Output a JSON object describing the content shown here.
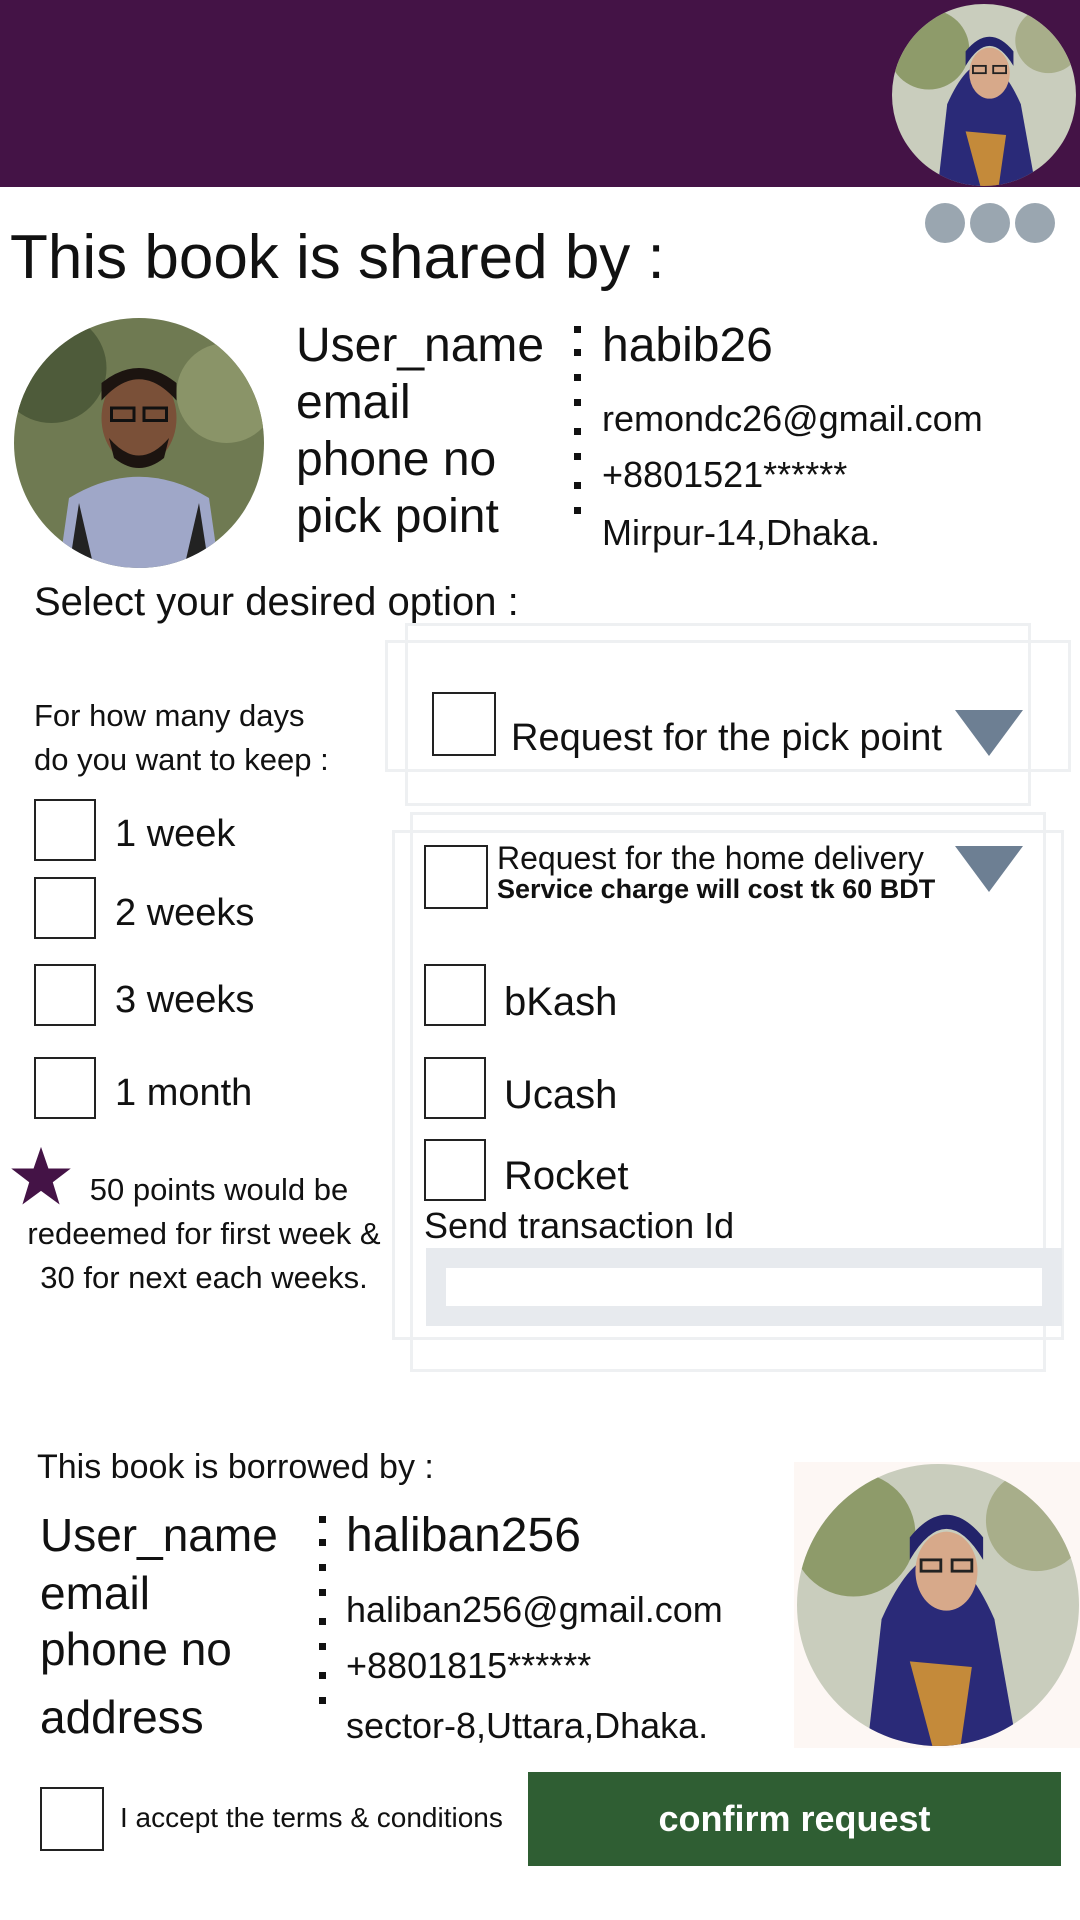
{
  "header": {
    "menu_icon": "more-dots-icon",
    "bar_color": "#441346"
  },
  "sharer": {
    "title": "This book is shared by :",
    "labels": {
      "user_name": "User_name",
      "email": "email",
      "phone": "phone no",
      "pick_point": "pick point"
    },
    "values": {
      "user_name": "habib26",
      "email": "remondc26@gmail.com",
      "phone": "+8801521******",
      "pick_point": "Mirpur-14,Dhaka."
    }
  },
  "options": {
    "title": "Select your desired option :",
    "days_question_line1": "For how many days",
    "days_question_line2": "do you want to keep :",
    "durations": [
      "1 week",
      "2 weeks",
      "3 weeks",
      "1 month"
    ],
    "points_note_line1": "50 points would be",
    "points_note_line2": "redeemed for first week &",
    "points_note_line3": "30 for next each weeks.",
    "star_icon": "star-icon",
    "star_color": "#441346"
  },
  "delivery": {
    "pick_point_label": "Request for the pick point",
    "home_delivery_label": "Request for the home delivery",
    "service_charge_note": "Service charge will cost tk 60 BDT",
    "payment_methods": [
      "bKash",
      "Ucash",
      "Rocket"
    ],
    "transaction_label": "Send transaction Id",
    "transaction_placeholder": ""
  },
  "borrower": {
    "title": "This book is borrowed by :",
    "labels": {
      "user_name": "User_name",
      "email": "email",
      "phone": "phone no",
      "address": "address"
    },
    "values": {
      "user_name": "haliban256",
      "email": "haliban256@gmail.com",
      "phone": "+8801815******",
      "address": "sector-8,Uttara,Dhaka."
    }
  },
  "footer": {
    "terms_label": "I accept the terms & conditions",
    "confirm_label": "confirm request",
    "confirm_color": "#2f5e33"
  }
}
